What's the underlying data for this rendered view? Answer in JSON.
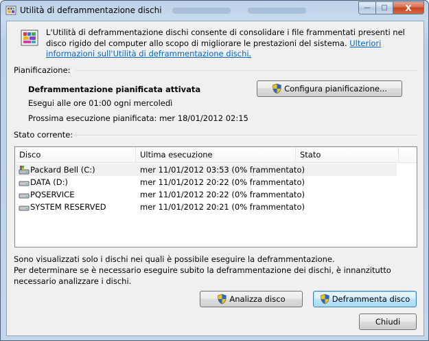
{
  "window": {
    "title": "Utilità di deframmentazione dischi",
    "caption_buttons": {
      "minimize": "—",
      "maximize": "□",
      "close": "X"
    }
  },
  "intro": {
    "text": "L'Utilità di deframmentazione dischi consente di consolidare i file frammentati presenti nel disco rigido del computer allo scopo di migliorare le prestazioni del sistema. ",
    "link": "Ulteriori informazioni sull'Utilità di deframmentazione dischi."
  },
  "schedule": {
    "section_label": "Pianificazione:",
    "status": "Deframmentazione pianificata attivata",
    "run_time": "Esegui alle ore 01:00 ogni mercoledì",
    "next_run": "Prossima esecuzione pianificata: mer 18/01/2012 02:15",
    "configure_button": "Configura pianificazione..."
  },
  "current": {
    "section_label": "Stato corrente:",
    "columns": [
      "Disco",
      "Ultima esecuzione",
      "Stato"
    ],
    "rows": [
      {
        "disk": "Packard Bell (C:)",
        "last_run": "mer 11/01/2012 03:53 (0% frammentato)",
        "status": "",
        "icon": "system-drive-icon"
      },
      {
        "disk": "DATA (D:)",
        "last_run": "mer 11/01/2012 20:22 (0% frammentato)",
        "status": "",
        "icon": "drive-icon"
      },
      {
        "disk": "PQSERVICE",
        "last_run": "mer 11/01/2012 20:22 (0% frammentato)",
        "status": "",
        "icon": "drive-icon"
      },
      {
        "disk": "SYSTEM RESERVED",
        "last_run": "mer 11/01/2012 20:21 (0% frammentato)",
        "status": "",
        "icon": "drive-icon"
      }
    ]
  },
  "notes": {
    "line1": "Sono visualizzati solo i dischi nei quali è possibile eseguire la deframmentazione.",
    "line2": "Per determinare se è necessario eseguire subito la deframmentazione dei dischi, è innanzitutto necessario analizzare i dischi."
  },
  "actions": {
    "analyze": "Analizza disco",
    "defragment": "Deframmenta disco",
    "close": "Chiudi"
  },
  "colors": {
    "link": "#0066cc",
    "window_frame": "#c2d6ec",
    "client_bg": "#f0f0f0"
  }
}
